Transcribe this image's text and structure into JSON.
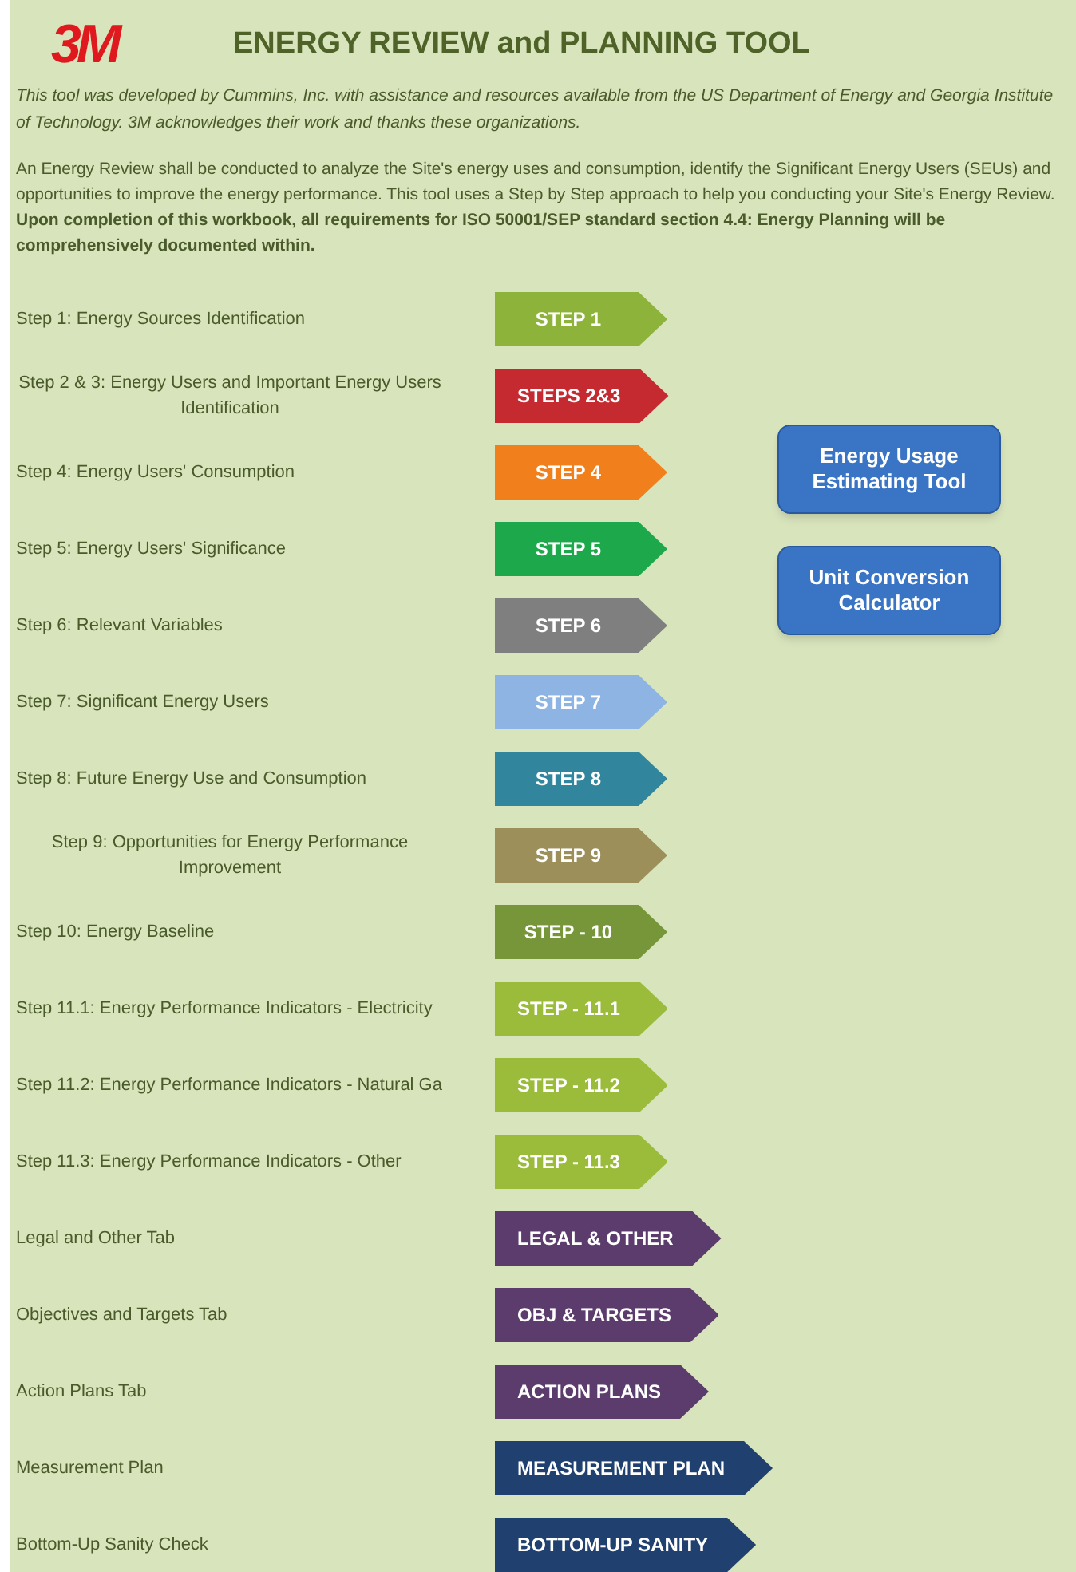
{
  "header": {
    "logo": "3M",
    "title": "ENERGY REVIEW and PLANNING TOOL"
  },
  "intro": "This tool was developed by Cummins, Inc. with assistance and resources available from the US Department of Energy and Georgia Institute of Technology.  3M acknowledges their work and thanks these organizations.",
  "description": "An Energy Review shall be conducted to analyze the Site's energy uses and consumption, identify the Significant Energy Users (SEUs) and opportunities to improve the energy performance. This tool uses a Step by Step approach to help you conducting your Site's Energy Review. **Upon completion of this workbook, all requirements for ISO 50001/SEP standard section 4.4: Energy Planning will be comprehensively documented within.**",
  "steps": [
    {
      "label": "Step 1:  Energy Sources Identification",
      "button": "STEP 1",
      "color": "#8db33a"
    },
    {
      "label": "Step 2 & 3:  Energy Users and Important Energy Users Identification",
      "button": "STEPS 2&3",
      "color": "#c42a30"
    },
    {
      "label": "Step 4:  Energy Users' Consumption",
      "button": "STEP 4",
      "color": "#f07f1c"
    },
    {
      "label": "Step 5:  Energy Users' Significance",
      "button": "STEP 5",
      "color": "#1ea84c"
    },
    {
      "label": "Step 6:  Relevant Variables",
      "button": "STEP 6",
      "color": "#7f7f7f"
    },
    {
      "label": "Step 7:  Significant Energy Users",
      "button": "STEP 7",
      "color": "#8db4e2"
    },
    {
      "label": "Step 8: Future Energy Use and Consumption",
      "button": "STEP 8",
      "color": "#31859c"
    },
    {
      "label": "Step 9: Opportunities for Energy Performance Improvement",
      "button": "STEP 9",
      "color": "#9c8f5a"
    },
    {
      "label": "Step 10: Energy Baseline",
      "button": "STEP - 10",
      "color": "#77963a"
    },
    {
      "label": "Step 11.1: Energy Performance Indicators - Electricity",
      "button": "STEP - 11.1",
      "color": "#9bbb3b"
    },
    {
      "label": "Step 11.2: Energy Performance Indicators - Natural Ga",
      "button": "STEP - 11.2",
      "color": "#9bbb3b"
    },
    {
      "label": "Step 11.3: Energy Performance Indicators - Other",
      "button": "STEP - 11.3",
      "color": "#9bbb3b"
    },
    {
      "label": "Legal and Other Tab",
      "button": "LEGAL & OTHER",
      "color": "#5b3c6c"
    },
    {
      "label": "Objectives and Targets Tab",
      "button": "OBJ & TARGETS",
      "color": "#5b3c6c"
    },
    {
      "label": "Action Plans Tab",
      "button": "ACTION PLANS",
      "color": "#5b3c6c"
    },
    {
      "label": "Measurement Plan",
      "button": "MEASUREMENT PLAN",
      "color": "#20406f"
    },
    {
      "label": "Bottom-Up Sanity Check",
      "button": "BOTTOM-UP SANITY",
      "color": "#20406f"
    }
  ],
  "tools": [
    "Energy Usage Estimating Tool",
    "Unit Conversion Calculator"
  ]
}
